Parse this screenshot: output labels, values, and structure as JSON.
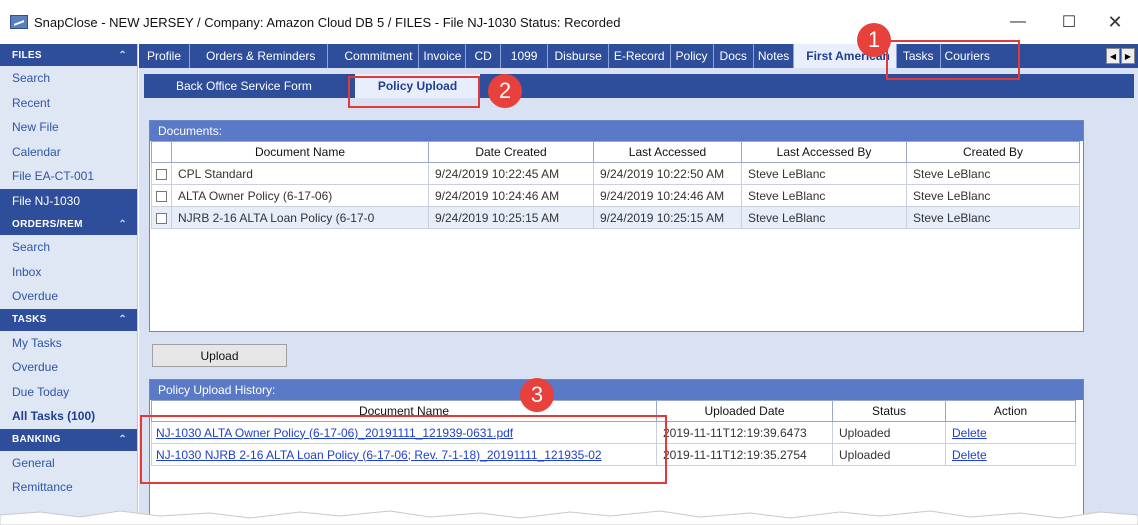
{
  "window": {
    "title": "SnapClose - NEW JERSEY / Company: Amazon Cloud DB 5 / FILES - File NJ-1030  Status: Recorded",
    "minimize": "—",
    "maximize": "☐",
    "close": "✕"
  },
  "sidebar": {
    "sections": [
      {
        "header": "FILES",
        "items": [
          "Search",
          "Recent",
          "New File",
          "Calendar",
          "File EA-CT-001",
          "File NJ-1030"
        ],
        "active": "File NJ-1030"
      },
      {
        "header": "ORDERS/REM",
        "items": [
          "Search",
          "Inbox",
          "Overdue"
        ]
      },
      {
        "header": "TASKS",
        "items": [
          "My Tasks",
          "Overdue",
          "Due Today",
          "All Tasks (100)"
        ],
        "bold": "All Tasks (100)"
      },
      {
        "header": "BANKING",
        "items": [
          "General",
          "Remittance"
        ]
      }
    ]
  },
  "tabs": [
    "Profile",
    "Orders & Reminders",
    "Commitment",
    "Invoice",
    "CD",
    "1099",
    "Disburse",
    "E-Record",
    "Policy",
    "Docs",
    "Notes",
    "First American",
    "Tasks",
    "Couriers"
  ],
  "selected_tab": "First American",
  "subtabs": [
    "Back Office Service Form",
    "Policy Upload"
  ],
  "selected_subtab": "Policy Upload",
  "documents": {
    "title": "Documents:",
    "columns": [
      "Document Name",
      "Date Created",
      "Last Accessed",
      "Last Accessed By",
      "Created By"
    ],
    "rows": [
      [
        "CPL Standard",
        "9/24/2019 10:22:45 AM",
        "9/24/2019 10:22:50 AM",
        "Steve LeBlanc",
        "Steve LeBlanc"
      ],
      [
        "ALTA Owner Policy (6-17-06)",
        "9/24/2019 10:24:46 AM",
        "9/24/2019 10:24:46 AM",
        "Steve LeBlanc",
        "Steve LeBlanc"
      ],
      [
        "NJRB 2-16 ALTA Loan Policy (6-17-0",
        "9/24/2019 10:25:15 AM",
        "9/24/2019 10:25:15 AM",
        "Steve LeBlanc",
        "Steve LeBlanc"
      ]
    ]
  },
  "upload_button": "Upload",
  "history": {
    "title": "Policy Upload History:",
    "columns": [
      "Document Name",
      "Uploaded Date",
      "Status",
      "Action"
    ],
    "rows": [
      [
        "NJ-1030 ALTA Owner Policy (6-17-06)_20191111_121939-0631.pdf",
        "2019-11-11T12:19:39.6473",
        "Uploaded",
        "Delete"
      ],
      [
        "NJ-1030 NJRB 2-16 ALTA Loan Policy (6-17-06; Rev. 7-1-18)_20191111_121935-02",
        "2019-11-11T12:19:35.2754",
        "Uploaded",
        "Delete"
      ]
    ]
  },
  "callouts": [
    "1",
    "2",
    "3"
  ],
  "colors": {
    "accent": "#2e4d9b",
    "callout": "#e8403a",
    "panel_head": "#5a79c7"
  }
}
